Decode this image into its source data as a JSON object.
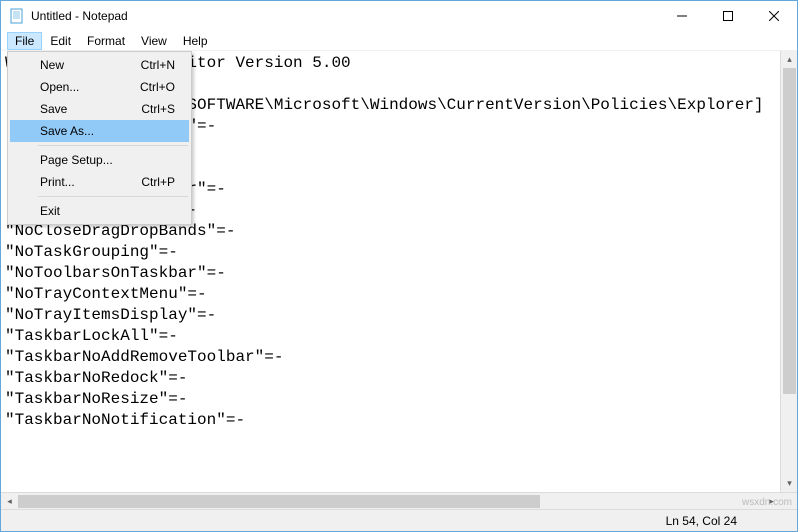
{
  "title": "Untitled - Notepad",
  "menu": {
    "items": [
      "File",
      "Edit",
      "Format",
      "View",
      "Help"
    ],
    "open_index": 0
  },
  "file_menu": {
    "new": {
      "label": "New",
      "shortcut": "Ctrl+N"
    },
    "open": {
      "label": "Open...",
      "shortcut": "Ctrl+O"
    },
    "save": {
      "label": "Save",
      "shortcut": "Ctrl+S"
    },
    "saveas": {
      "label": "Save As...",
      "shortcut": ""
    },
    "pagesetup": {
      "label": "Page Setup...",
      "shortcut": ""
    },
    "print": {
      "label": "Print...",
      "shortcut": "Ctrl+P"
    },
    "exit": {
      "label": "Exit",
      "shortcut": ""
    }
  },
  "editor_text": "Windows Registry Editor Version 5.00\n\n[HKEY_CURRENT_USER\\SOFTWARE\\Microsoft\\Windows\\CurrentVersion\\Policies\\Explorer]\n\"NoTrayItemsDisplay\"=-\n\"HideClock\"=-\n\"NoTaskGrouping\"=-\n\"NoToolbarsOnTaskbar\"=-\n\"NoMovingToolbars\"=-\n\"NoCloseDragDropBands\"=-\n\"NoTaskGrouping\"=-\n\"NoToolbarsOnTaskbar\"=-\n\"NoTrayContextMenu\"=-\n\"NoTrayItemsDisplay\"=-\n\"TaskbarLockAll\"=-\n\"TaskbarNoAddRemoveToolbar\"=-\n\"TaskbarNoRedock\"=-\n\"TaskbarNoResize\"=-\n\"TaskbarNoNotification\"=-\n",
  "status": "Ln 54, Col 24",
  "watermark": "wsxdn.com"
}
